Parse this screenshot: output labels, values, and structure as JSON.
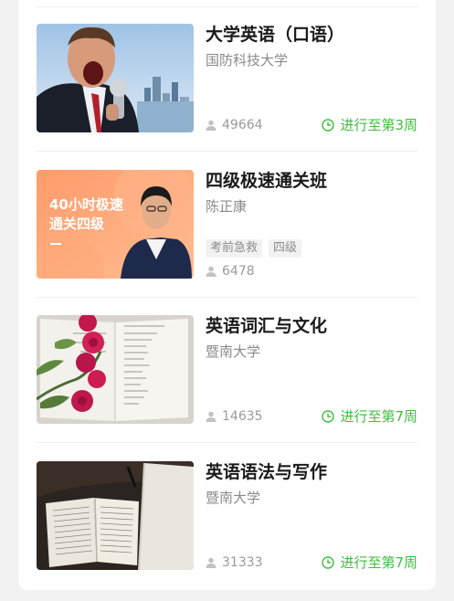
{
  "colors": {
    "progress_green": "#3fbc3f",
    "title_text": "#1a1a1a",
    "meta_text": "#8a8a8a"
  },
  "courses": [
    {
      "title": "大学英语（口语）",
      "subtitle": "国防科技大学",
      "tags": [],
      "students": "49664",
      "progress": "进行至第3周",
      "thumbnail": "shouting-businessman-microphone"
    },
    {
      "title": "四级极速通关班",
      "subtitle": "陈正康",
      "tags": [
        "考前急救",
        "四级"
      ],
      "students": "6478",
      "progress": "",
      "thumbnail": "orange-promo-teacher",
      "thumbnail_caption": "40小时极速\n通关四级"
    },
    {
      "title": "英语词汇与文化",
      "subtitle": "暨南大学",
      "tags": [],
      "students": "14635",
      "progress": "进行至第7周",
      "thumbnail": "roses-on-open-book"
    },
    {
      "title": "英语语法与写作",
      "subtitle": "暨南大学",
      "tags": [],
      "students": "31333",
      "progress": "进行至第7周",
      "thumbnail": "open-bible-on-table"
    }
  ],
  "icons": {
    "students": "person-icon",
    "progress": "clock-icon"
  }
}
